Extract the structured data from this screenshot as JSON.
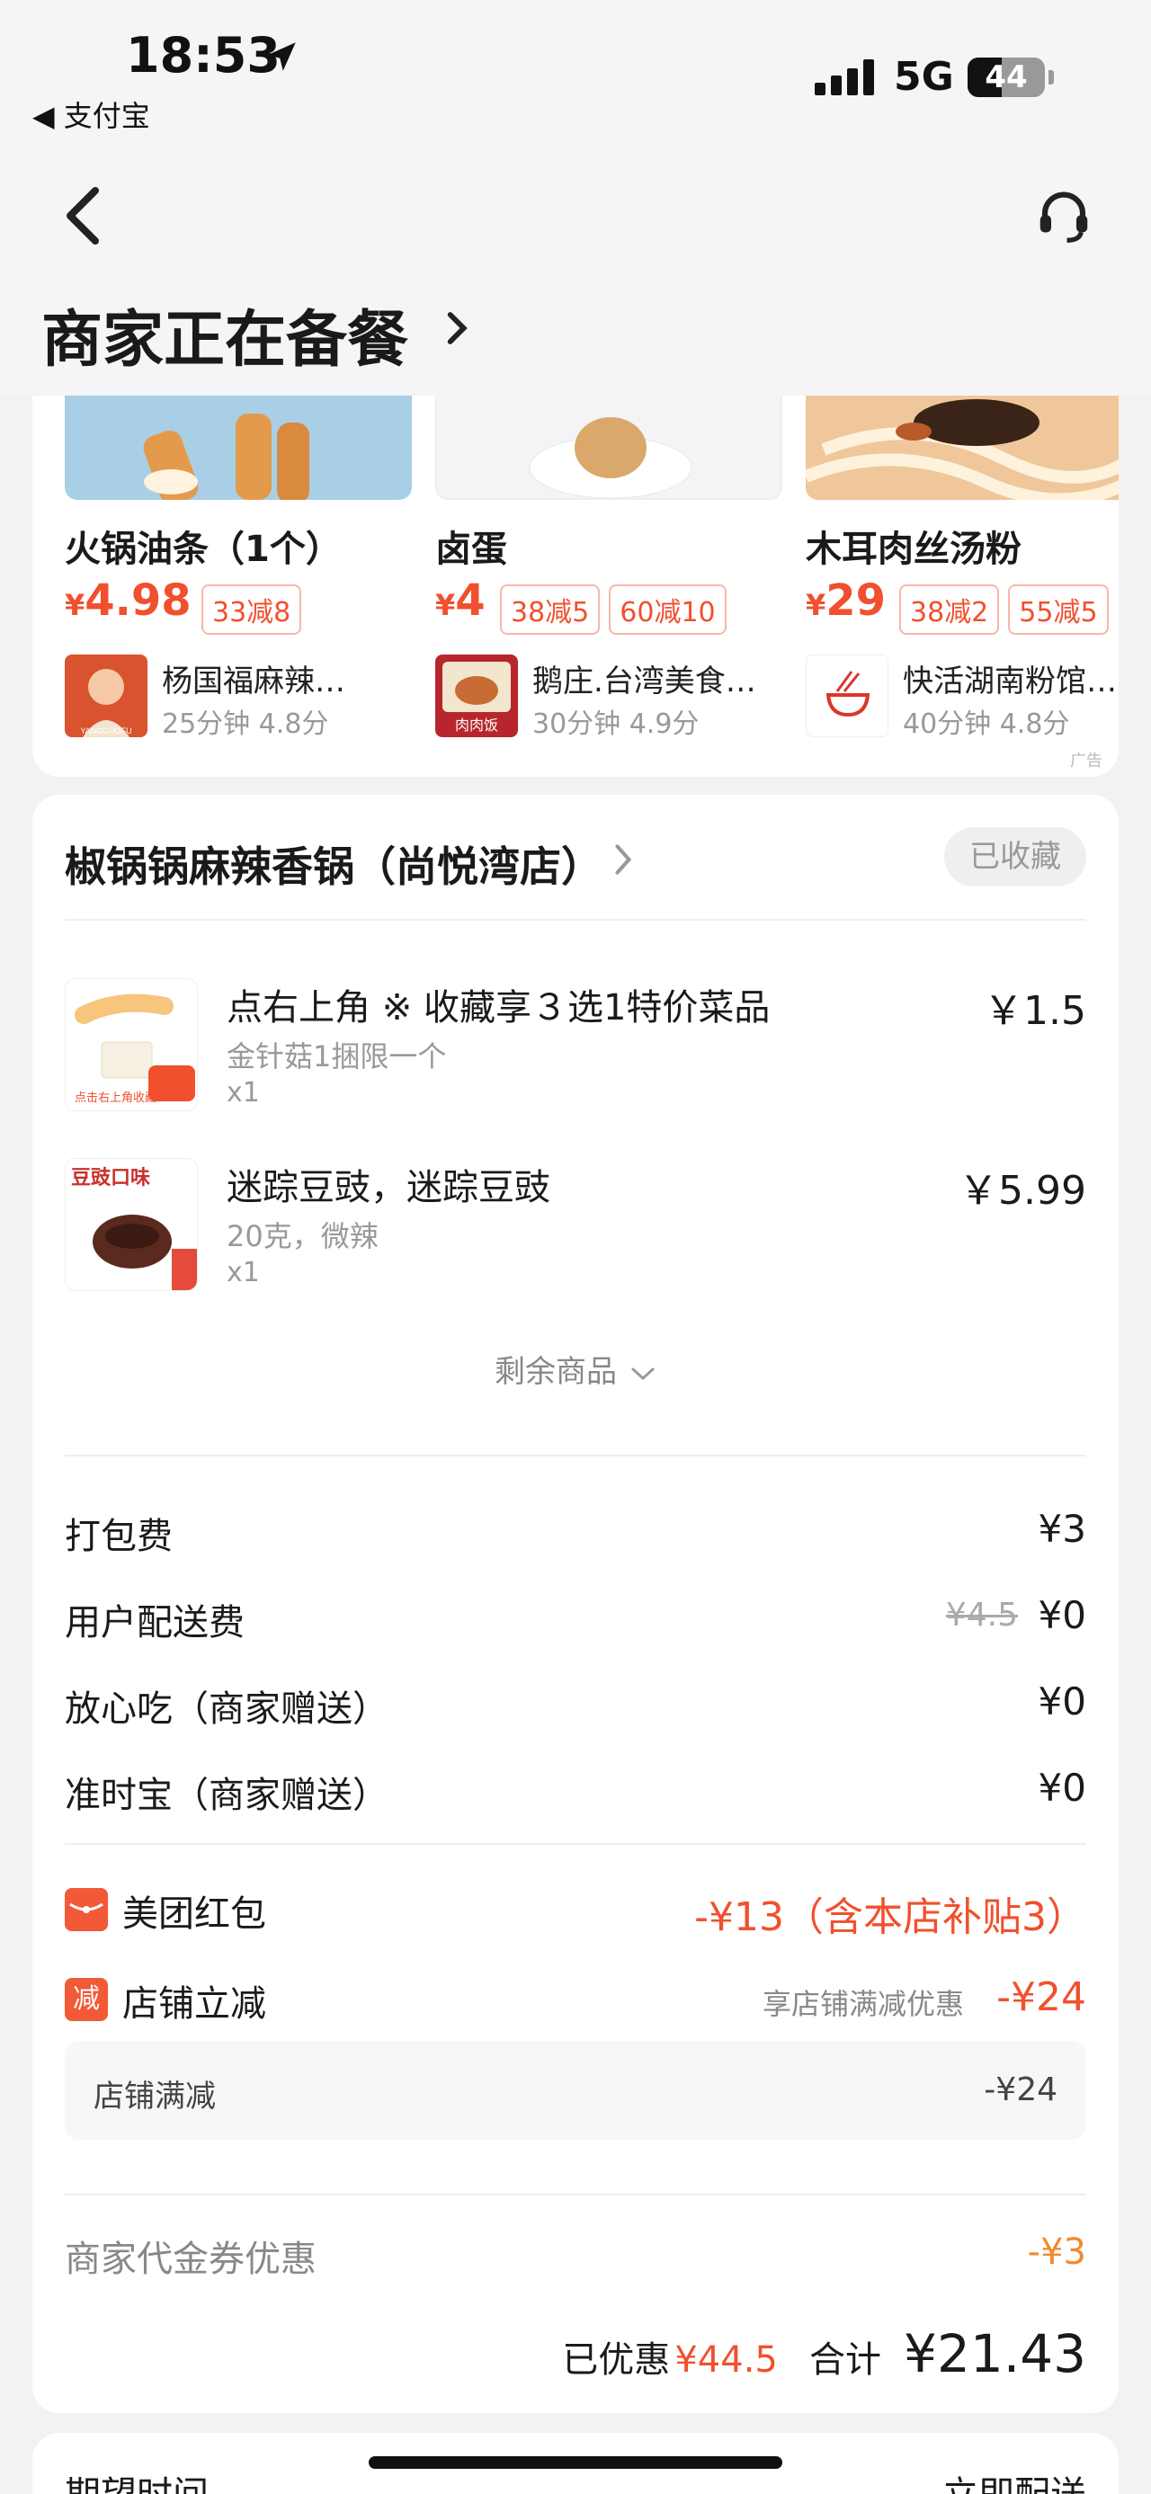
{
  "status_bar": {
    "time": "18:53",
    "back_app": "◀ 支付宝",
    "network": "5G",
    "battery": "44",
    "battery_level": 0.44
  },
  "header": {
    "title": "商家正在备餐"
  },
  "recommendations": {
    "ad_tag": "广告",
    "items": [
      {
        "name": "火锅油条（1个）",
        "price_symbol": "¥",
        "price": "4.98",
        "badges": [
          "33减8"
        ],
        "shop": "杨国福麻辣…",
        "meta": "25分钟  4.8分",
        "logo_text": "YANGGUOFU"
      },
      {
        "name": "卤蛋",
        "price_symbol": "¥",
        "price": "4",
        "badges": [
          "38减5",
          "60减10"
        ],
        "shop": "鹅庄.台湾美食…",
        "meta": "30分钟  4.9分",
        "logo_text": "肉肉饭"
      },
      {
        "name": "木耳肉丝汤粉",
        "price_symbol": "¥",
        "price": "29",
        "badges": [
          "38减2",
          "55减5"
        ],
        "shop": "快活湖南粉馆…",
        "meta": "40分钟  4.8分",
        "logo_text": ""
      }
    ]
  },
  "order": {
    "store_name": "椒锅锅麻辣香锅（尚悦湾店）",
    "favorite_label": "已收藏",
    "items": [
      {
        "name": "点右上角 ※ 收藏享３选1特价菜品",
        "spec": "金针菇1捆限一个",
        "qty": "x1",
        "price": "￥1.5",
        "thumb_text": "点击右上角收藏"
      },
      {
        "name": "迷踪豆豉，迷踪豆豉",
        "spec": "20克，微辣",
        "qty": "x1",
        "price": "￥5.99",
        "thumb_text": "豆豉口味"
      }
    ],
    "more_label": "剩余商品",
    "fees": {
      "packing": {
        "label": "打包费",
        "value": "¥3"
      },
      "delivery": {
        "label": "用户配送费",
        "old": "¥4.5",
        "value": "¥0"
      },
      "safe_eat": {
        "label": "放心吃（商家赠送）",
        "value": "¥0"
      },
      "on_time": {
        "label": "准时宝（商家赠送）",
        "value": "¥0"
      }
    },
    "promos": {
      "red_packet": {
        "label": "美团红包",
        "value": "-¥13（含本店补贴3）"
      },
      "store_discount": {
        "icon": "减",
        "label": "店铺立减",
        "note": "享店铺满减优惠",
        "value": "-¥24"
      },
      "sub": {
        "label": "店铺满减",
        "value": "-¥24"
      }
    },
    "voucher": {
      "label": "商家代金券优惠",
      "value": "-¥3"
    },
    "summary": {
      "saved_label": "已优惠",
      "saved_value": "¥44.5",
      "total_label": "合计",
      "total_value": "¥21.43"
    }
  },
  "bottom": {
    "left": "期望时间",
    "right": "立即配送"
  },
  "colors": {
    "accent": "#f0502e",
    "voucher": "#f08a2e",
    "background": "#f2f2f4"
  }
}
